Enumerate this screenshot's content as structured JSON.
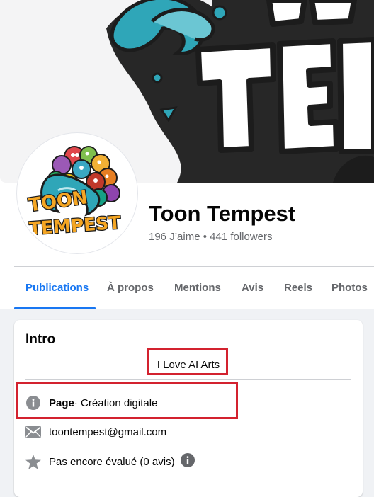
{
  "profile": {
    "name": "Toon Tempest",
    "stats": "196 J’aime • 441 followers",
    "logo_text_line1": "TOON",
    "logo_text_line2": "TEMPEST"
  },
  "tabs": [
    {
      "label": "Publications",
      "active": true
    },
    {
      "label": "À propos",
      "active": false
    },
    {
      "label": "Mentions",
      "active": false
    },
    {
      "label": "Avis",
      "active": false
    },
    {
      "label": "Reels",
      "active": false
    },
    {
      "label": "Photos",
      "active": false
    }
  ],
  "intro": {
    "title": "Intro",
    "bio": "I Love AI Arts",
    "category_label": "Page",
    "category_value": " · Création digitale",
    "email": "toontempest@gmail.com",
    "rating": "Pas encore évalué (0 avis)"
  },
  "colors": {
    "accent": "#1877f2",
    "highlight_box": "#d3222f",
    "secondary_text": "#65676b",
    "background": "#f0f2f5"
  },
  "icons": [
    "info-icon",
    "mail-icon",
    "star-icon",
    "info-small-icon"
  ]
}
